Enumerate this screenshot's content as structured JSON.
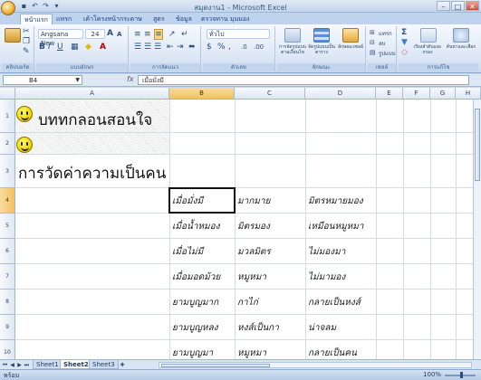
{
  "window": {
    "title": "สมุดงาน1 - Microsoft Excel",
    "controls": [
      "–",
      "□",
      "✕"
    ]
  },
  "tabs": [
    "หน้าแรก",
    "แทรก",
    "เค้าโครงหน้ากระดาษ",
    "สูตร",
    "ข้อมูล",
    "ตรวจทาน",
    "มุมมอง"
  ],
  "ribbon": {
    "font_name": "Angsana New",
    "font_size": "24",
    "number_format": "ทั่วไป",
    "groups": [
      "คลิปบอร์ด",
      "แบบอักษร",
      "การจัดแนว",
      "ตัวเลข",
      "ลักษณะ",
      "เซลล์",
      "การแก้ไข"
    ],
    "conditional_label": "การจัดรูปแบบตามเงื่อนไข",
    "format_table_label": "จัดรูปแบบเป็นตาราง",
    "cell_styles_label": "ลักษณะเซลล์",
    "insert_label": "แทรก",
    "delete_label": "ลบ",
    "format_label": "รูปแบบ",
    "sort_label": "เรียงลำดับและกรอง",
    "find_label": "ค้นหาและเลือก"
  },
  "formula_bar": {
    "name_box": "B4",
    "fx": "fx",
    "content": "เมื่อมั่งมี"
  },
  "columns": [
    "A",
    "B",
    "C",
    "D",
    "E",
    "F",
    "G",
    "H"
  ],
  "rows": [
    "1",
    "2",
    "3",
    "4",
    "5",
    "6",
    "7",
    "8",
    "9",
    "10"
  ],
  "cells": {
    "a1": "บททกลอนสอนใจ",
    "a3": "การวัดค่าความเป็นคน",
    "b": [
      "เมื่อมั่งมี",
      "เมื่อน้ำหมอง",
      "เมื่อไม่มี",
      "เมื่อมอดม้วย",
      "ยามบูญมาก",
      "ยามบูญหลง",
      "ยามบูญมา"
    ],
    "c": [
      "มากมาย",
      "มิตรมอง",
      "มวลมิตร",
      "หมูหมา",
      "กาไก่",
      "หงส์เป็นกา",
      "หมูหมา"
    ],
    "d": [
      "มิตรหมายมอง",
      "เหมือนหมูหมา",
      "ไม่มองมา",
      "ไม่มามอง",
      "กลายเป็นหงส์",
      "น่าจลม",
      "กลายเป็นคน"
    ]
  },
  "sheets": [
    "Sheet1",
    "Sheet2",
    "Sheet3"
  ],
  "status": {
    "left": "พร้อม",
    "zoom": "100%"
  }
}
